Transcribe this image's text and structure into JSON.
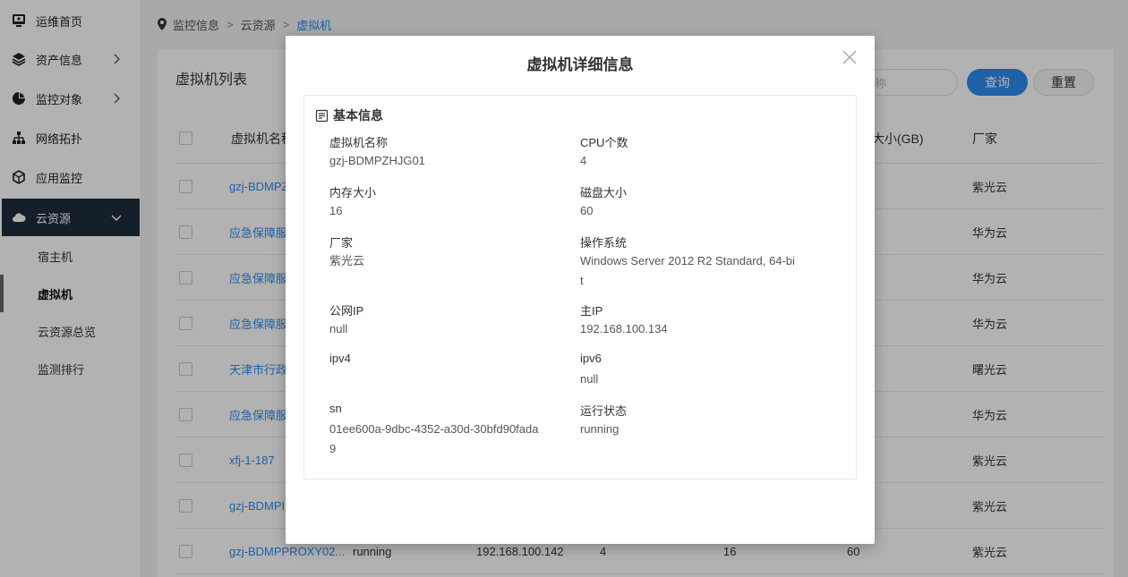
{
  "sidebar": {
    "items": [
      {
        "label": "运维首页",
        "icon": "monitor-icon",
        "has_chevron": false
      },
      {
        "label": "资产信息",
        "icon": "layers-icon",
        "has_chevron": true
      },
      {
        "label": "监控对象",
        "icon": "pie-chart-icon",
        "has_chevron": true
      },
      {
        "label": "网络拓扑",
        "icon": "sitemap-icon",
        "has_chevron": false
      },
      {
        "label": "应用监控",
        "icon": "cube-icon",
        "has_chevron": false
      },
      {
        "label": "云资源",
        "icon": "cloud-icon",
        "has_chevron": true,
        "active": true
      }
    ],
    "sub_items": [
      {
        "label": "宿主机"
      },
      {
        "label": "虚拟机",
        "active": true
      },
      {
        "label": "云资源总览"
      },
      {
        "label": "监测排行"
      }
    ]
  },
  "breadcrumb": {
    "items": [
      "监控信息",
      "云资源",
      "虚拟机"
    ]
  },
  "panel": {
    "title": "虚拟机列表",
    "search_placeholder": "称",
    "query_label": "查询",
    "reset_label": "重置"
  },
  "table": {
    "headers": {
      "name": "虚拟机名称",
      "disk": "大小(GB)",
      "vendor": "厂家"
    },
    "rows": [
      {
        "name": "gzj-BDMPZ",
        "vendor": "紫光云"
      },
      {
        "name": "应急保障服",
        "vendor": "华为云"
      },
      {
        "name": "应急保障服",
        "vendor": "华为云"
      },
      {
        "name": "应急保障服",
        "vendor": "华为云"
      },
      {
        "name": "天津市行政",
        "vendor": "曙光云"
      },
      {
        "name": "应急保障服",
        "vendor": "华为云"
      },
      {
        "name": "xfj-1-187",
        "vendor": "紫光云"
      },
      {
        "name": "gzj-BDMPI",
        "vendor": "紫光云"
      },
      {
        "name": "gzj-BDMPPROXY02...",
        "status": "running",
        "ip": "192.168.100.142",
        "cpu": "4",
        "mem": "16",
        "disk": "60",
        "vendor": "紫光云"
      }
    ]
  },
  "modal": {
    "title": "虚拟机详细信息",
    "section_title": "基本信息",
    "fields": {
      "vm_name": {
        "label": "虚拟机名称",
        "value": "gzj-BDMPZHJG01"
      },
      "cpu": {
        "label": "CPU个数",
        "value": "4"
      },
      "memory": {
        "label": "内存大小",
        "value": "16"
      },
      "disk": {
        "label": "磁盘大小",
        "value": "60"
      },
      "vendor": {
        "label": "厂家",
        "value": "紫光云"
      },
      "os": {
        "label": "操作系统",
        "value": "Windows Server 2012 R2 Standard, 64-bit"
      },
      "public_ip": {
        "label": "公网IP",
        "value": "null"
      },
      "main_ip": {
        "label": "主IP",
        "value": "192.168.100.134"
      },
      "ipv4": {
        "label": "ipv4",
        "value": ""
      },
      "ipv6": {
        "label": "ipv6",
        "value": "null"
      },
      "sn": {
        "label": "sn",
        "value": "01ee600a-9dbc-4352-a30d-30bfd90fada9"
      },
      "run_state": {
        "label": "运行状态",
        "value": "running"
      }
    }
  },
  "colors": {
    "accent": "#2d8cf0",
    "sidebar_active_bg": "#1f2d3d"
  }
}
